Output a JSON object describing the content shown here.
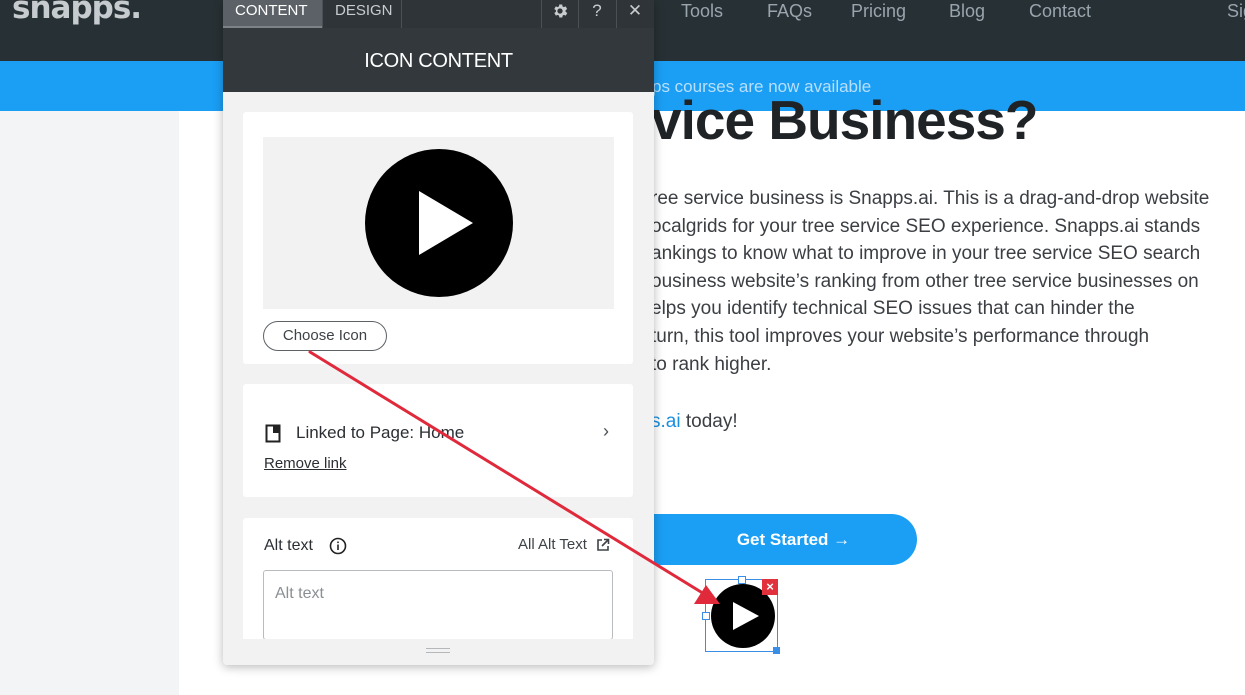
{
  "site": {
    "logo": "snapps.",
    "nav": [
      "Tools",
      "FAQs",
      "Pricing",
      "Blog",
      "Contact",
      "Sig"
    ],
    "announcement": "ps courses are now available",
    "hero_title": "vice Business?",
    "hero_lines": [
      "ree service business is Snapps.ai. This is a drag-and-drop website",
      "ocalgrids for your tree service SEO experience. Snapps.ai stands",
      "ankings to know what to improve in your tree service SEO search",
      "ousiness website’s ranking from other tree service businesses on",
      "elps you identify technical SEO issues that can hinder the",
      "turn, this tool improves your website’s performance through",
      "to rank higher."
    ],
    "today_link": "s.ai",
    "today_rest": " today!",
    "cta": "Get Started →"
  },
  "panel": {
    "tabs": [
      "CONTENT",
      "DESIGN"
    ],
    "active_tab": "CONTENT",
    "help": "?",
    "close": "✕",
    "title": "ICON CONTENT",
    "choose_icon": "Choose Icon",
    "linked_label": "Linked to Page: Home",
    "remove_link": "Remove link",
    "alt_label": "Alt text",
    "all_alt": "All Alt Text",
    "alt_placeholder": "Alt text",
    "alt_value": ""
  },
  "colors": {
    "header_bg": "#273034",
    "announcement_bg": "#1a9ff4",
    "panel_dark": "#33383c",
    "annotation_arrow": "#e02a3b",
    "selection_blue": "#3a8ee6"
  },
  "icons": {
    "settings": "gear-icon",
    "help": "help-icon",
    "close": "close-icon",
    "preview": "play-circle-icon",
    "link_page": "page-icon",
    "chevron": "chevron-right-icon",
    "info": "info-icon",
    "external": "external-link-icon"
  }
}
